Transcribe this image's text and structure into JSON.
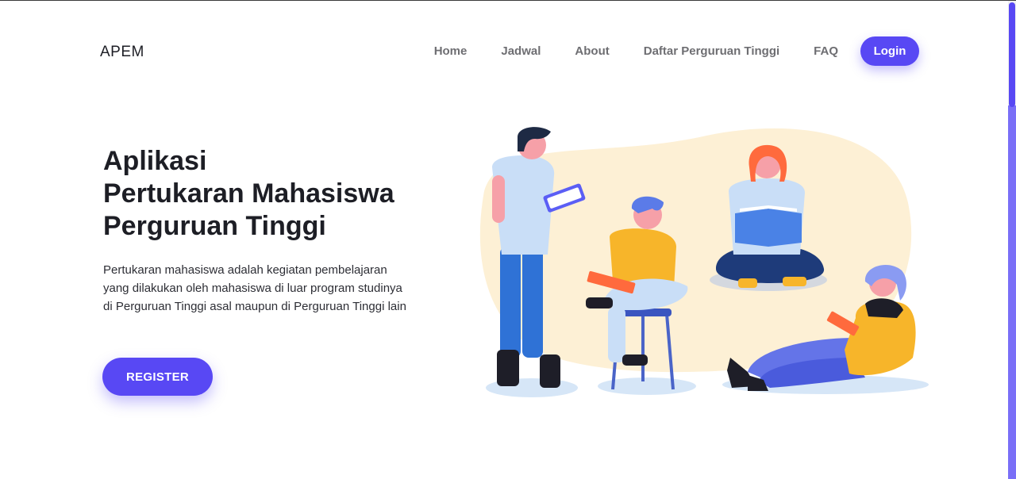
{
  "navbar": {
    "brand": "APEM",
    "links": [
      "Home",
      "Jadwal",
      "About",
      "Daftar Perguruan Tinggi",
      "FAQ"
    ],
    "login_label": "Login"
  },
  "hero": {
    "title_lines": [
      "Aplikasi",
      "Pertukaran Mahasiswa",
      "Perguruan Tinggi"
    ],
    "description": "Pertukaran mahasiswa adalah kegiatan pembelajaran yang dilakukan oleh mahasiswa di luar program studinya di Perguruan Tinggi asal maupun di Perguruan Tinggi lain",
    "register_label": "REGISTER"
  },
  "colors": {
    "accent": "#5848f4",
    "blob": "#fdf0d5",
    "text": "#1d1e25",
    "nav_text": "#6e6e72"
  }
}
